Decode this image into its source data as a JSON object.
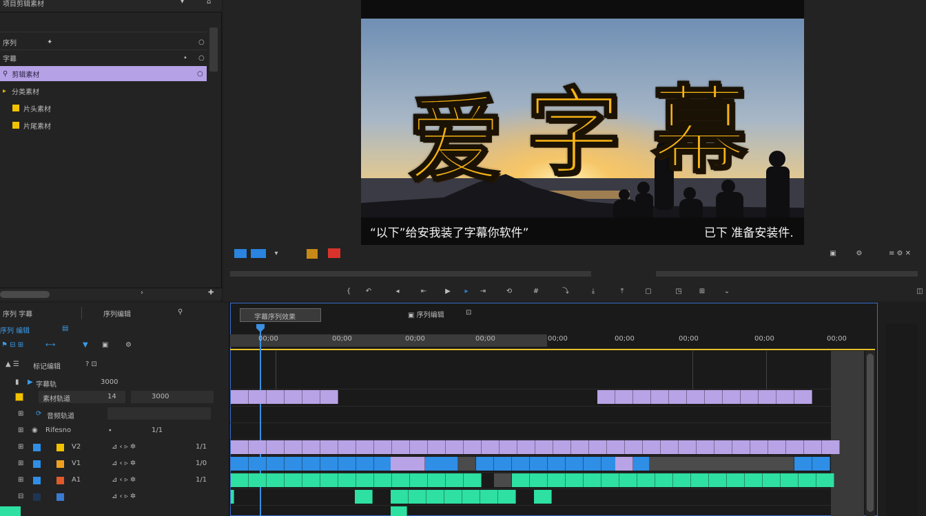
{
  "project_panel": {
    "header_label": "项目剪辑素材",
    "rows": [
      {
        "label": "序列"
      },
      {
        "label": "字幕"
      },
      {
        "label": "剪辑素材"
      },
      {
        "label": "分类素材"
      },
      {
        "label": "片头素材"
      },
      {
        "label": "片尾素材"
      }
    ]
  },
  "monitor": {
    "title_text": [
      "爱",
      "字",
      "幕"
    ],
    "subtitle_left": "“以下”给安我装了字幕你软件”",
    "subtitle_right": "已下 准备安装件.",
    "controls": [
      "标记",
      "入点",
      "出点",
      "播放",
      "下一帧",
      "插入",
      "覆盖",
      "导出"
    ]
  },
  "timeline": {
    "sequence_tab": "字幕序列效果",
    "header_left": "序列 字幕",
    "header_tools": "序列编辑",
    "track_menu": "序列 编辑",
    "marker_tab": "标记编辑",
    "ruler_labels": [
      "00;00",
      "00;00",
      "00;00",
      "00;00",
      "00;00",
      "00;00",
      "00;00",
      "00;00",
      "00;00"
    ],
    "tracks": [
      {
        "name": "字幕轨",
        "value": "3000"
      },
      {
        "name": "素材轨道",
        "value": "14"
      },
      {
        "name": "音频轨道",
        "value": "3000"
      },
      {
        "name": "Rifesno",
        "value": "1/1"
      },
      {
        "name": "V2",
        "value": "1/1"
      },
      {
        "name": "V1",
        "value": "1/0"
      },
      {
        "name": "A1",
        "value": "1/1"
      }
    ]
  },
  "colors": {
    "accent_purple": "#b8a3e6",
    "clip_blue": "#2f8ee6",
    "clip_green": "#2ee0a2",
    "playhead": "#3a8fe0",
    "title_orange": "#f7b315"
  }
}
